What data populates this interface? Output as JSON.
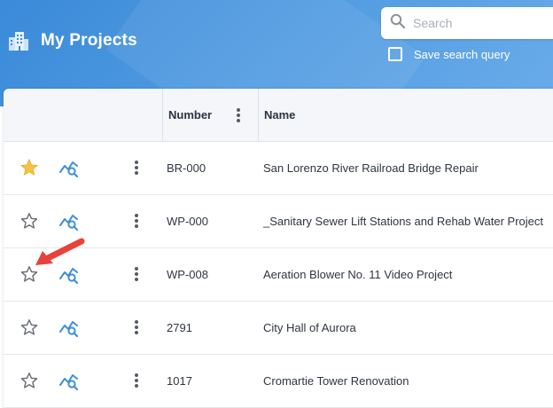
{
  "header": {
    "title": "My Projects",
    "brand_icon": "building-icon",
    "search_placeholder": "Search",
    "save_query_label": "Save search query",
    "save_query_checked": false
  },
  "table": {
    "columns": [
      {
        "label": ""
      },
      {
        "label": "Number"
      },
      {
        "label": "Name"
      }
    ],
    "rows": [
      {
        "starred": true,
        "number": "BR-000",
        "name": "San Lorenzo River Railroad Bridge Repair"
      },
      {
        "starred": false,
        "number": "WP-000",
        "name": "_Sanitary Sewer Lift Stations and Rehab Water Project"
      },
      {
        "starred": false,
        "number": "WP-008",
        "name": "Aeration Blower No. 11 Video Project"
      },
      {
        "starred": false,
        "number": "2791",
        "name": "City Hall of Aurora"
      },
      {
        "starred": false,
        "number": "1017",
        "name": "Cromartie Tower Renovation"
      }
    ]
  },
  "colors": {
    "header_start": "#3a8ad9",
    "header_end": "#6aacea",
    "star_filled": "#f5c342",
    "star_outline": "#6b7178",
    "analytics_icon": "#3f8fd8",
    "annotation_arrow": "#e8423a"
  }
}
